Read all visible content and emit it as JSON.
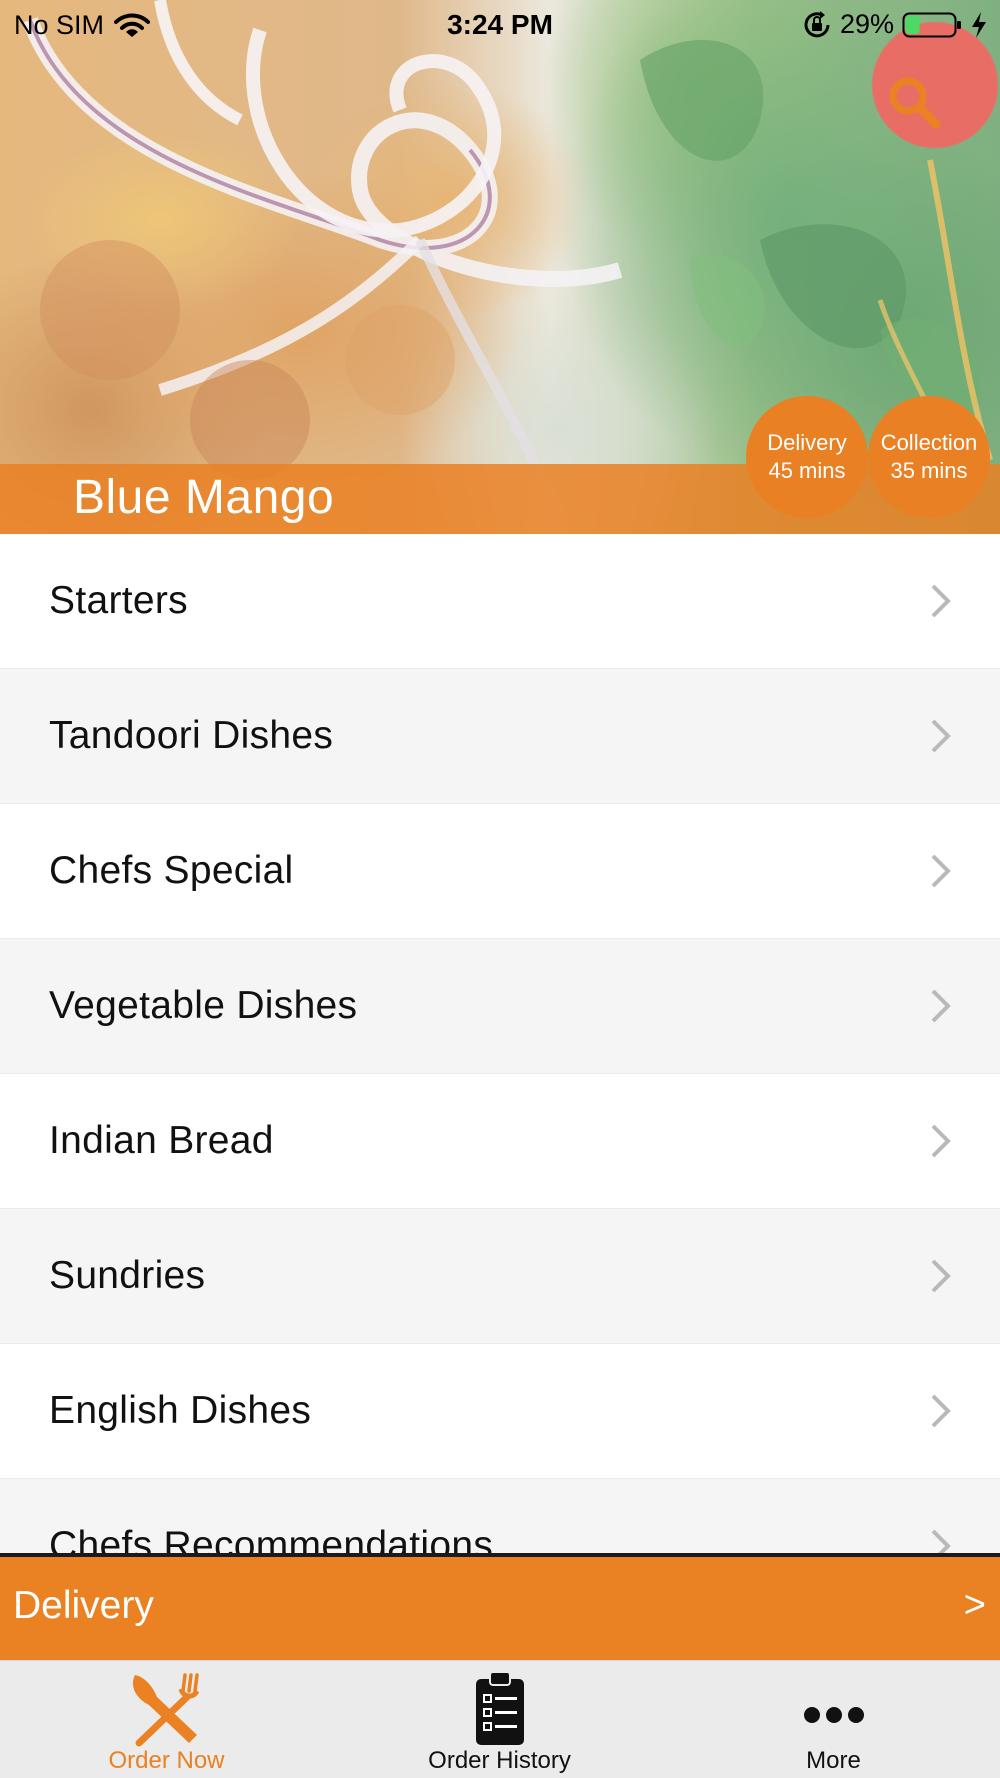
{
  "status_bar": {
    "carrier": "No SIM",
    "time": "3:24 PM",
    "battery_percent": "29%",
    "battery_level": 0.29,
    "battery_color": "#4cd964",
    "icons": [
      "wifi-icon",
      "lock-rotation-icon",
      "battery-icon",
      "bolt-icon"
    ]
  },
  "header": {
    "restaurant_name": "Blue Mango",
    "search_icon": "search-icon",
    "delivery": {
      "label": "Delivery",
      "time": "45 mins"
    },
    "collection": {
      "label": "Collection",
      "time": "35 mins"
    }
  },
  "menu": {
    "chevron_icon": "chevron-right-icon",
    "items": [
      {
        "label": "Starters"
      },
      {
        "label": "Tandoori Dishes"
      },
      {
        "label": "Chefs Special"
      },
      {
        "label": "Vegetable Dishes"
      },
      {
        "label": "Indian Bread"
      },
      {
        "label": "Sundries"
      },
      {
        "label": "English Dishes"
      },
      {
        "label": "Chefs Recommendations"
      }
    ]
  },
  "order_bar": {
    "mode": "Delivery",
    "arrow": ">"
  },
  "tab_bar": {
    "tabs": [
      {
        "label": "Order Now",
        "icon": "fork-knife-icon",
        "active": true
      },
      {
        "label": "Order History",
        "icon": "clipboard-list-icon",
        "active": false
      },
      {
        "label": "More",
        "icon": "more-dots-icon",
        "active": false
      }
    ]
  },
  "colors": {
    "accent": "#ea8122",
    "tab_inactive": "#111111",
    "tab_bar_bg": "#ebebeb",
    "row_alt": "#f5f5f5",
    "status_text": "#000000"
  }
}
